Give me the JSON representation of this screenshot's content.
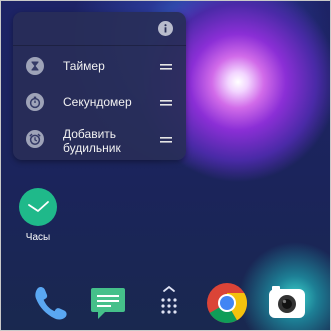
{
  "shortcut_menu": {
    "items": [
      {
        "label": "Таймер",
        "icon": "hourglass-icon"
      },
      {
        "label": "Секундомер",
        "icon": "stopwatch-icon"
      },
      {
        "label": "Добавить\nбудильник",
        "icon": "alarm-clock-icon"
      }
    ],
    "info_icon": "info-icon",
    "drag_icon": "drag-handle-icon"
  },
  "home": {
    "clock_app": {
      "label": "Часы",
      "icon": "clock-icon",
      "color": "#1fb98a"
    }
  },
  "dock": {
    "items": [
      {
        "icon": "phone-icon"
      },
      {
        "icon": "messages-icon"
      },
      {
        "icon": "app-drawer-icon"
      },
      {
        "icon": "chrome-icon"
      },
      {
        "icon": "camera-icon"
      }
    ]
  },
  "colors": {
    "popup_background": "#282e58",
    "accent_green": "#1fb98a"
  }
}
